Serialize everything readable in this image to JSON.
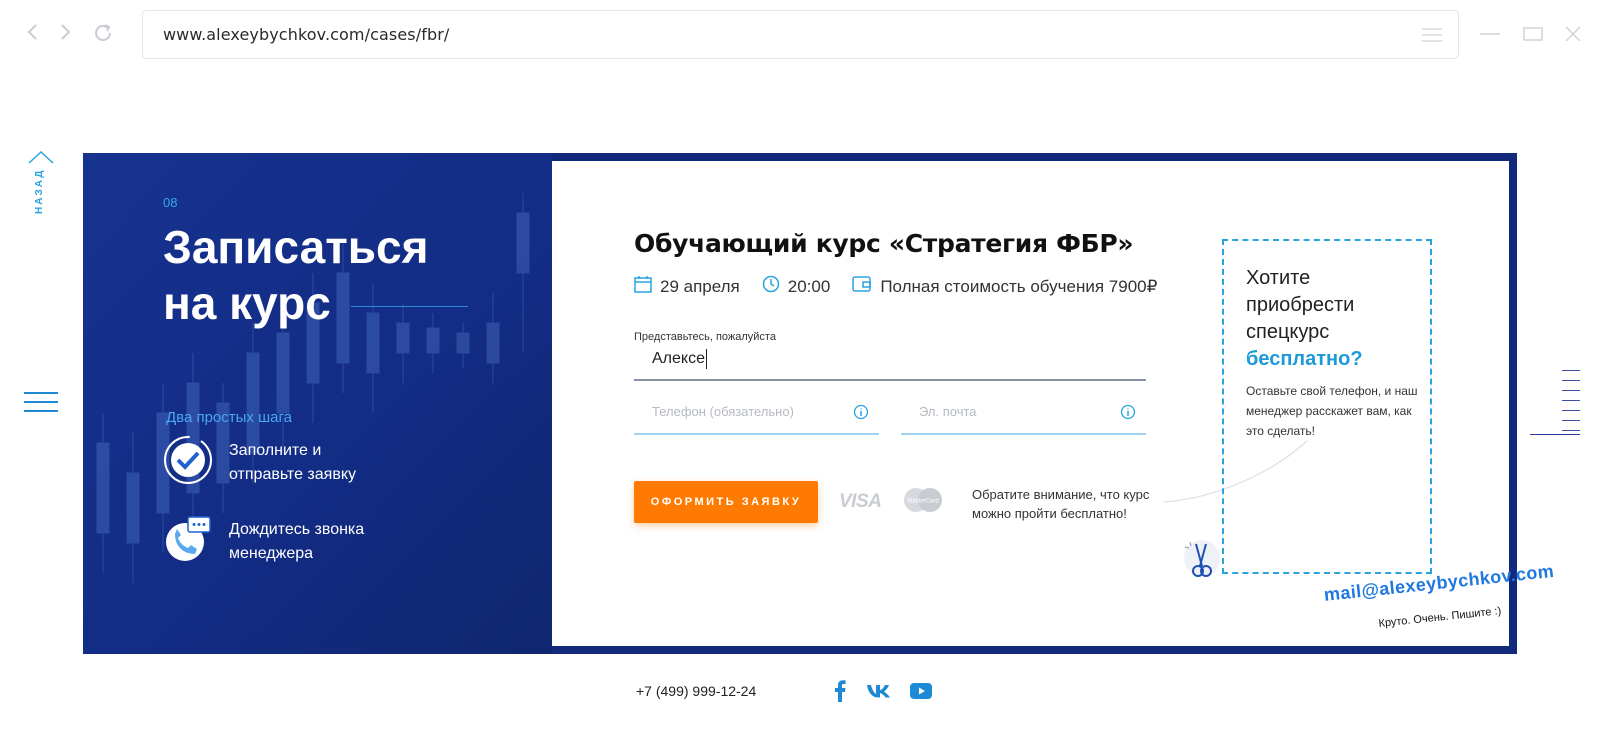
{
  "browser": {
    "url": "www.alexeybychkov.com/cases/fbr/",
    "icons": [
      "back-arrow-icon",
      "forward-arrow-icon",
      "reload-icon",
      "menu-icon",
      "minimize-icon",
      "maximize-icon",
      "close-icon"
    ]
  },
  "side": {
    "back_label": "НАЗАД"
  },
  "hero": {
    "step_number": "08",
    "title_line1": "Записаться",
    "title_line2": "на курс",
    "steps_label": "Два простых шага",
    "steps": [
      {
        "text": "Заполните и отправьте заявку",
        "icon": "checkmark-icon"
      },
      {
        "text": "Дождитесь звонка менеджера",
        "icon": "phone-chat-icon"
      }
    ]
  },
  "form": {
    "title": "Обучающий курс «Стратегия ФБР»",
    "date": "29 апреля",
    "time": "20:00",
    "price": "Полная стоимость обучения 7900₽",
    "name_label": "Представьтесь, пожалуйста",
    "name_value": "Алексе",
    "phone_placeholder": "Телефон (обязательно)",
    "email_placeholder": "Эл. почта",
    "submit_label": "ОФОРМИТЬ ЗАЯВКУ",
    "card_visa": "VISA",
    "card_mastercard": "MasterCard",
    "note": "Обратите внимание, что курс можно пройти бесплатно!"
  },
  "promo": {
    "question_part1": "Хотите приобрести спецкурс",
    "question_highlight": "бесплатно?",
    "description": "Оставьте свой телефон, и наш менеджер расскажет вам, как это сделать!"
  },
  "signature": {
    "email": "mail@alexeybychkov.com",
    "caption": "Круто. Очень. Пишите :)"
  },
  "footer": {
    "phone": "+7 (499) 999-12-24",
    "social": [
      "facebook-icon",
      "vk-icon",
      "youtube-icon"
    ]
  },
  "colors": {
    "hero_blue": "#12297e",
    "accent_blue": "#29a3e0",
    "orange": "#ff7a00"
  }
}
